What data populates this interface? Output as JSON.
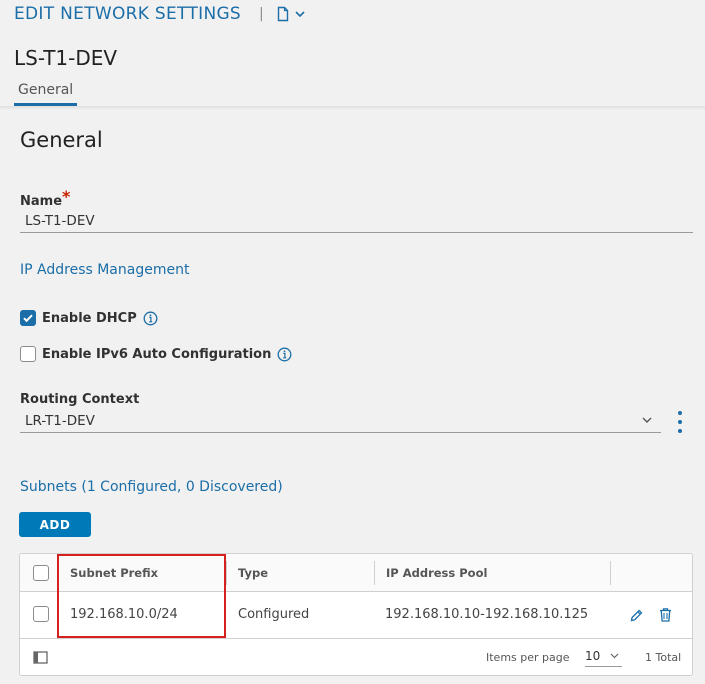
{
  "header": {
    "title": "EDIT NETWORK SETTINGS",
    "separator": "|",
    "object_name": "LS-T1-DEV",
    "tabs": [
      {
        "label": "General"
      }
    ]
  },
  "form": {
    "section_title": "General",
    "name_label": "Name",
    "required_mark": "*",
    "name_value": "LS-T1-DEV",
    "ip_mgmt_heading": "IP Address Management",
    "enable_dhcp_label": "Enable DHCP",
    "enable_dhcp_checked": true,
    "enable_ipv6_label": "Enable IPv6 Auto Configuration",
    "enable_ipv6_checked": false,
    "routing_context_label": "Routing Context",
    "routing_context_value": "LR-T1-DEV",
    "subnets_heading": "Subnets (1 Configured, 0 Discovered)",
    "add_label": "ADD"
  },
  "subnets_grid": {
    "columns": [
      "Subnet Prefix",
      "Type",
      "IP Address Pool"
    ],
    "rows": [
      {
        "prefix": "192.168.10.0/24",
        "type": "Configured",
        "pool": "192.168.10.10-192.168.10.125"
      }
    ],
    "items_per_page_label": "Items per page",
    "items_per_page_value": "10",
    "total": "1 Total"
  },
  "colors": {
    "accent": "#1b6ea8",
    "button": "#0079b8",
    "required": "#c92100",
    "highlight": "#d62020"
  },
  "icons": [
    "document-icon",
    "chevron-down-icon",
    "info-icon",
    "kebab-menu-icon",
    "edit-icon",
    "trash-icon",
    "column-toggle-icon"
  ]
}
